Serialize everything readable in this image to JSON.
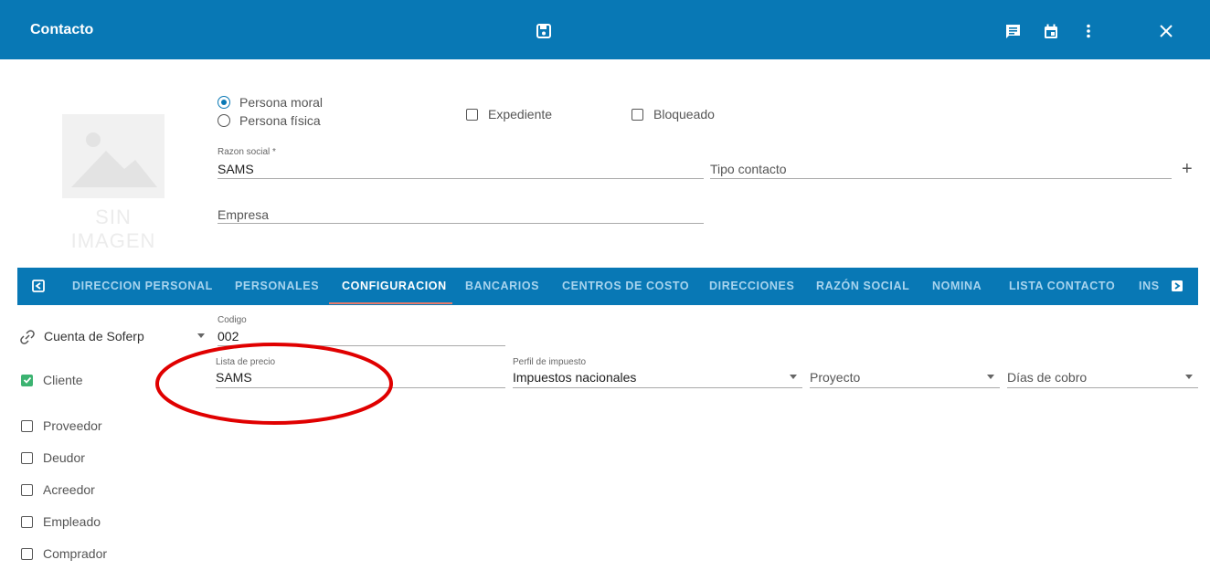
{
  "header": {
    "title": "Contacto",
    "bg_color": "#0878b5"
  },
  "icons": {
    "save": "save-icon",
    "comment": "comment-icon",
    "calendar": "calendar-icon",
    "more": "more-vert-icon",
    "close": "close-icon"
  },
  "image_placeholder": {
    "text": "SIN IMAGEN"
  },
  "person_type": {
    "option_moral": "Persona moral",
    "option_fisica": "Persona física",
    "selected": "Persona moral"
  },
  "checks_top": {
    "expediente": "Expediente",
    "bloqueado": "Bloqueado"
  },
  "form": {
    "razon_social_label": "Razon social *",
    "razon_social_value": "SAMS",
    "tipo_contacto_placeholder": "Tipo contacto",
    "add_symbol": "+",
    "empresa_placeholder": "Empresa"
  },
  "tabs": {
    "items": [
      "DIRECCION PERSONAL",
      "PERSONALES",
      "CONFIGURACION",
      "BANCARIOS",
      "CENTROS DE COSTO",
      "DIRECCIONES",
      "RAZÓN SOCIAL",
      "NOMINA",
      "LISTA CONTACTO",
      "INS"
    ],
    "active": "CONFIGURACION"
  },
  "config": {
    "cuenta_select": "Cuenta de Soferp",
    "codigo_label": "Codigo",
    "codigo_value": "002",
    "lista_precio_label": "Lista de precio",
    "lista_precio_value": "SAMS",
    "perfil_label": "Perfil de impuesto",
    "perfil_value": "Impuestos nacionales",
    "proyecto_placeholder": "Proyecto",
    "dias_cobro_placeholder": "Días de cobro"
  },
  "roles": [
    {
      "label": "Cliente",
      "checked": true
    },
    {
      "label": "Proveedor",
      "checked": false
    },
    {
      "label": "Deudor",
      "checked": false
    },
    {
      "label": "Acreedor",
      "checked": false
    },
    {
      "label": "Empleado",
      "checked": false
    },
    {
      "label": "Comprador",
      "checked": false
    }
  ],
  "annotation_color": "#e00000"
}
